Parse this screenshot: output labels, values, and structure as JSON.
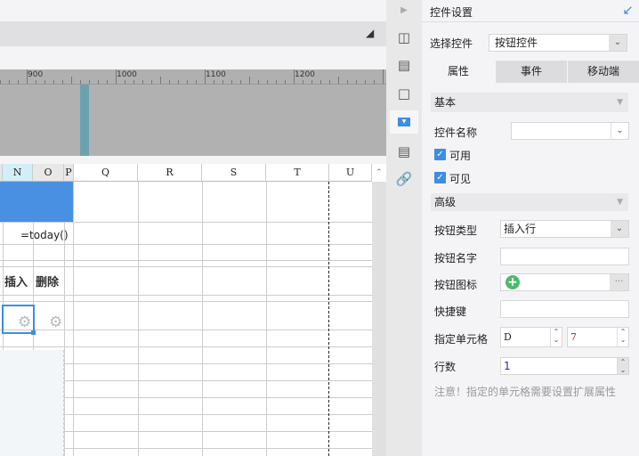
{
  "ruler": {
    "labels": [
      "900",
      "1000",
      "1100",
      "1200"
    ]
  },
  "grid": {
    "columns": [
      "N",
      "O",
      "P",
      "Q",
      "R",
      "S",
      "T",
      "U"
    ],
    "formula_cell": "=today()",
    "insert_label": "插入",
    "delete_label": "删除"
  },
  "panel": {
    "title": "控件设置",
    "select_widget_label": "选择控件",
    "select_widget_value": "按钮控件",
    "tabs": [
      "属性",
      "事件",
      "移动端"
    ],
    "basic_section": "基本",
    "widget_name_label": "控件名称",
    "widget_name_value": "",
    "enabled_label": "可用",
    "visible_label": "可见",
    "advanced_section": "高级",
    "button_type_label": "按钮类型",
    "button_type_value": "插入行",
    "button_name_label": "按钮名字",
    "button_name_value": "",
    "button_icon_label": "按钮图标",
    "button_icon_more": "···",
    "shortcut_label": "快捷键",
    "shortcut_value": "",
    "cell_label": "指定单元格",
    "cell_column": "D",
    "cell_row": "7",
    "rows_label": "行数",
    "rows_value": "1",
    "note": "注意！指定的单元格需要设置扩展属性"
  },
  "colors": {
    "accent": "#3a8ee6",
    "selection_fill": "#4a90e2",
    "icon_green": "#4cbb6c"
  }
}
